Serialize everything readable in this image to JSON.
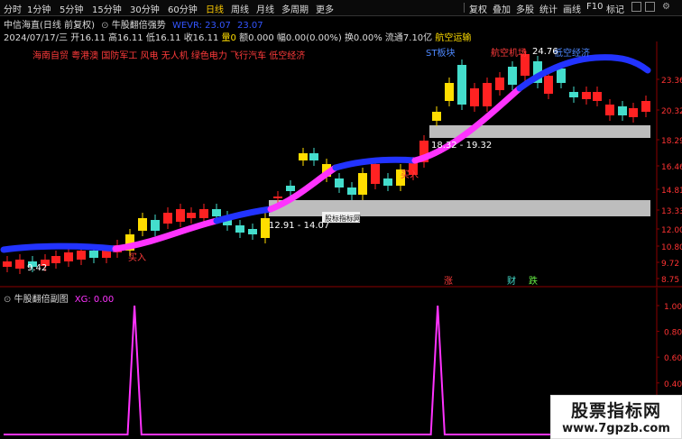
{
  "toolbar": {
    "items": [
      "分时",
      "1分钟",
      "5分钟",
      "15分钟",
      "30分钟",
      "60分钟",
      "日线",
      "周线",
      "月线",
      "多周期",
      "更多"
    ],
    "right_items": [
      "复权",
      "叠加",
      "多股",
      "统计",
      "画线",
      "F10",
      "标记"
    ]
  },
  "header": {
    "stock": "中信海直(日线 前复权)",
    "indicator": "牛股翻倍强势",
    "wevr_label": "WEVR: 23.07",
    "wevr_value": "23.07",
    "date": "2024/07/17/三",
    "open": "开16.11",
    "high": "高16.11",
    "low": "低16.11",
    "close": "收16.11",
    "volume": "量0",
    "amount": "额0.000",
    "change": "幅0.00(0.00%)",
    "turnover": "换0.00%",
    "float_cap": "流通7.10亿",
    "industry": "航空运输"
  },
  "concept_tags": "海南自贸 粤港澳 国防军工 风电 无人机 绿色电力 飞行汽车 低空经济",
  "chart_labels": {
    "st_sector": "ST板块",
    "aviation": "航空机场",
    "low_altitude": "低空经济",
    "high_price": "24.76",
    "range_upper": "18.32 - 19.32",
    "range_lower": "12.91 - 14.07",
    "low_price": "9.42",
    "buy_label": "买入",
    "watermark_box": "股标指标网",
    "zhang": "涨",
    "cai": "财",
    "die": "跌"
  },
  "y_axis": [
    "23.36",
    "20.32",
    "18.29",
    "16.46",
    "14.81",
    "13.33",
    "12.00",
    "10.80",
    "9.72",
    "8.75"
  ],
  "sub_chart": {
    "title": "牛股翻倍副图",
    "xg_label": "XG: 0.00",
    "y_axis": [
      "1.00",
      "0.80",
      "0.60",
      "0.40",
      "0.20",
      "0.00"
    ]
  },
  "chart_data": {
    "type": "line",
    "series": [
      {
        "name": "XG",
        "values": [
          0,
          0,
          0,
          0,
          0,
          0,
          0,
          0,
          0,
          0,
          0,
          0,
          0,
          0,
          0,
          0,
          0,
          0,
          0,
          1,
          0,
          0,
          0,
          0,
          0,
          0,
          0,
          0,
          0,
          0,
          0,
          0,
          0,
          0,
          0,
          0,
          0,
          0,
          0,
          0,
          0,
          0,
          0,
          0,
          0,
          0,
          0,
          0,
          0,
          0,
          0,
          0,
          0,
          0,
          0,
          0,
          0,
          0,
          0,
          0,
          0,
          0,
          0,
          1,
          0,
          0,
          0,
          0,
          0,
          0,
          0,
          0,
          0,
          0,
          0,
          0,
          0,
          0,
          0,
          0,
          0,
          0,
          0,
          0,
          0,
          0,
          0,
          0,
          0,
          0,
          0,
          0,
          0,
          0,
          0
        ]
      }
    ],
    "ylim": [
      0,
      1
    ],
    "colors": {
      "line": "#ff33ff"
    }
  },
  "watermark": {
    "line1": "股票指标网",
    "line2": "www.7gpzb.com"
  },
  "colors": {
    "up": "#ff2222",
    "down": "#44ddcc",
    "yellow": "#ffdd00",
    "magenta": "#ff33ff",
    "blue": "#2233ff"
  }
}
